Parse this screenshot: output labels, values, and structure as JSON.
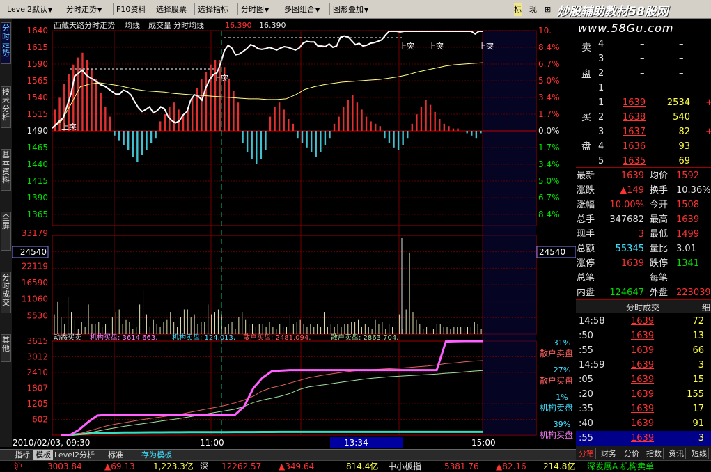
{
  "toolbar": {
    "items": [
      "Level2默认",
      "分时走势",
      "F10资料",
      "选择股票",
      "选择指标",
      "分时图",
      "多图组合",
      "图形叠加",
      "标",
      "现",
      "⊞"
    ]
  },
  "watermark": {
    "title": "炒股辅助教材58股网",
    "url": "www.58Gu.com"
  },
  "left_tabs": [
    "分时走势",
    "技术分析",
    "基本资料",
    "全屏",
    "分时成交",
    "其他"
  ],
  "chart": {
    "title_left": "西藏天路分时走势",
    "legend_labels": [
      "均线",
      "成交量",
      "分时均线"
    ],
    "legend_vals": [
      "16.390",
      "16.390"
    ],
    "price_axis": [
      "1640",
      "1615",
      "1590",
      "1565",
      "1540",
      "1515",
      "1490",
      "1465",
      "1440",
      "1415",
      "1390",
      "1365"
    ],
    "pct_axis": [
      "10.",
      "8.4%",
      "6.7%",
      "5.0%",
      "3.4%",
      "1.7%",
      "0.0%",
      "1.7%",
      "3.4%",
      "5.0%",
      "6.7%",
      "8.4%"
    ],
    "vol_axis": [
      "33179",
      "27648",
      "22119",
      "16590",
      "11060",
      "5530"
    ],
    "vol_marker": "24540",
    "ind_axis": [
      "3615",
      "3012",
      "2410",
      "1807",
      "1205",
      "602"
    ],
    "ind_legend": [
      "动态买卖",
      "机构买盘: 3614.663,",
      "机构卖盘: 124.013,",
      "散户买盘: 2481.094,",
      "散户卖盘: 2863.704,"
    ],
    "ind_right": [
      {
        "pct": "31%",
        "label": "散户卖盘"
      },
      {
        "pct": "27%",
        "label": "散户买盘"
      },
      {
        "pct": "1%",
        "label": "机构卖盘"
      },
      {
        "pct": "39%",
        "label": "机构买盘"
      }
    ],
    "shangtu": "上突",
    "time_axis": [
      "2010/02/03, 09:30",
      "11:00",
      "13:34",
      "15:00"
    ],
    "price_line": [
      1494,
      1500,
      1505,
      1510,
      1528,
      1545,
      1572,
      1576,
      1581,
      1574,
      1570,
      1567,
      1563,
      1559,
      1557,
      1553,
      1549,
      1545,
      1545,
      1551,
      1549,
      1544,
      1534,
      1525,
      1519,
      1522,
      1526,
      1517,
      1520,
      1526,
      1523,
      1511,
      1505,
      1502,
      1505,
      1514,
      1519,
      1536,
      1544,
      1542,
      1536,
      1554,
      1566,
      1574,
      1577,
      1591,
      1610,
      1618,
      1614,
      1604,
      1605,
      1609,
      1613,
      1619,
      1617,
      1613,
      1612,
      1613,
      1615,
      1613,
      1611,
      1614,
      1616,
      1615,
      1613,
      1611,
      1614,
      1621,
      1624,
      1623,
      1623,
      1617,
      1617,
      1616,
      1620,
      1615,
      1617,
      1630,
      1632,
      1631,
      1625,
      1619,
      1621,
      1617,
      1618,
      1621,
      1622,
      1624,
      1626,
      1633,
      1639,
      1639,
      1639,
      1638,
      1639,
      1639,
      1639,
      1639,
      1639,
      1639,
      1639,
      1639,
      1639,
      1639,
      1639,
      1639,
      1639,
      1639,
      1639,
      1639,
      1639,
      1639,
      1639,
      1635,
      1639,
      1639
    ],
    "avg_line": [
      1494,
      1505,
      1530,
      1556,
      1560,
      1562,
      1560,
      1558,
      1555,
      1552,
      1550,
      1549,
      1548,
      1546,
      1545,
      1544,
      1543,
      1542,
      1541,
      1540,
      1539,
      1538,
      1538,
      1537,
      1537,
      1538,
      1544,
      1552,
      1556,
      1559,
      1561,
      1563,
      1564,
      1565,
      1566,
      1567,
      1569,
      1571,
      1574,
      1578,
      1581,
      1584,
      1587,
      1589,
      1590,
      1591,
      1592
    ],
    "vol_bars": [
      8,
      13,
      7,
      4,
      15,
      9,
      6,
      2,
      5,
      3,
      12,
      4,
      4,
      5,
      3,
      4,
      2,
      7,
      9,
      10,
      4,
      6,
      5,
      2,
      3,
      12,
      18,
      8,
      3,
      6,
      4,
      3,
      5,
      6,
      9,
      5,
      3,
      7,
      10,
      10,
      7,
      8,
      4,
      5,
      5,
      12,
      8,
      9,
      10,
      8,
      3,
      4,
      5,
      2,
      7,
      9,
      6,
      4,
      4,
      3,
      4,
      4,
      3,
      5,
      3,
      2,
      4,
      3,
      3,
      8,
      4,
      5,
      6,
      4,
      3,
      4,
      3,
      4,
      3,
      9,
      3,
      4,
      3,
      4,
      3,
      4,
      4,
      5,
      5,
      6,
      3,
      4,
      3,
      2,
      6,
      4,
      5,
      2,
      4,
      3,
      3,
      8,
      2,
      10,
      33,
      9,
      6,
      4,
      2,
      3,
      2,
      2,
      4,
      4,
      3,
      3,
      2,
      3,
      3,
      3,
      3,
      3,
      3,
      5,
      4,
      2
    ],
    "diff_bars": [
      9,
      14,
      20,
      24,
      28,
      31,
      33,
      30,
      26,
      22,
      16,
      10,
      6,
      -2,
      -4,
      -6,
      -8,
      -11,
      -13,
      -10,
      -8,
      -5,
      -3,
      4,
      7,
      10,
      12,
      9,
      7,
      10,
      14,
      18,
      22,
      25,
      28,
      30,
      30,
      27,
      22,
      17,
      12,
      -5,
      -9,
      -12,
      -14,
      -12,
      -8,
      6,
      10,
      12,
      9,
      5,
      3,
      -3,
      -5,
      -7,
      -9,
      -11,
      -9,
      -6,
      -3,
      3,
      6,
      10,
      13,
      15,
      12,
      9,
      6,
      4,
      3,
      2,
      -3,
      -5,
      -7,
      -8,
      -6,
      -3,
      3,
      7,
      10,
      13,
      11,
      8,
      5,
      3,
      2,
      1,
      1,
      0,
      -1,
      -2,
      -3,
      -1
    ],
    "inst_buy": [
      0,
      0,
      200,
      500,
      750,
      780,
      780,
      780,
      780,
      780,
      780,
      780,
      780,
      780,
      780,
      780,
      780,
      780,
      780,
      780,
      1100,
      1800,
      2200,
      2450,
      2480,
      2500,
      2500,
      2500,
      2500,
      2500,
      2500,
      2500,
      2500,
      2500,
      2500,
      2500,
      2500,
      2500,
      2500,
      2500,
      2500,
      2500,
      3600,
      3610,
      3614,
      3615,
      3615
    ],
    "retail_buy": [
      0,
      0,
      10,
      80,
      150,
      220,
      280,
      340,
      390,
      440,
      490,
      540,
      590,
      640,
      700,
      760,
      820,
      880,
      940,
      1000,
      1100,
      1250,
      1350,
      1420,
      1500,
      1600,
      1750,
      1850,
      1900,
      1950,
      2000,
      2050,
      2100,
      2150,
      2190,
      2220,
      2250,
      2270,
      2290,
      2310,
      2330,
      2350,
      2380,
      2400,
      2430,
      2460,
      2481
    ],
    "retail_sell": [
      0,
      0,
      50,
      150,
      250,
      350,
      420,
      480,
      540,
      600,
      650,
      700,
      750,
      800,
      870,
      940,
      1010,
      1070,
      1150,
      1240,
      1350,
      1500,
      1700,
      1820,
      1900,
      2000,
      2100,
      2200,
      2270,
      2330,
      2380,
      2430,
      2470,
      2500,
      2520,
      2540,
      2560,
      2580,
      2600,
      2630,
      2660,
      2700,
      2750,
      2780,
      2820,
      2850,
      2864
    ],
    "inst_sell": [
      0,
      0,
      40,
      60,
      80,
      90,
      95,
      100,
      102,
      105,
      107,
      108,
      110,
      111,
      112,
      113,
      114,
      115,
      116,
      117,
      118,
      119,
      120,
      121,
      122,
      122,
      123,
      123,
      123,
      123,
      124,
      124,
      124,
      124,
      124,
      124,
      124,
      124,
      124,
      124,
      124,
      124,
      124,
      124,
      124,
      124,
      124
    ]
  },
  "quote": {
    "asks": [
      {
        "lvl": "4",
        "p": "–",
        "v": "–"
      },
      {
        "lvl": "3",
        "p": "–",
        "v": "–"
      },
      {
        "lvl": "2",
        "p": "–",
        "v": "–"
      },
      {
        "lvl": "1",
        "p": "–",
        "v": "–"
      }
    ],
    "bids": [
      {
        "lvl": "1",
        "p": "1639",
        "v": "2534",
        "e": "+"
      },
      {
        "lvl": "2",
        "p": "1638",
        "v": "540",
        "e": ""
      },
      {
        "lvl": "3",
        "p": "1637",
        "v": "82",
        "e": "+"
      },
      {
        "lvl": "4",
        "p": "1636",
        "v": "93",
        "e": ""
      },
      {
        "lvl": "5",
        "p": "1635",
        "v": "69",
        "e": ""
      }
    ],
    "side_sell": [
      "卖",
      "盘"
    ],
    "side_buy": [
      "买",
      "盘"
    ],
    "stats": [
      {
        "l1": "最新",
        "v1": "1639",
        "c1": "red",
        "l2": "均价",
        "v2": "1592",
        "c2": "red"
      },
      {
        "l1": "涨跌",
        "v1": "▲149",
        "c1": "red",
        "l2": "换手",
        "v2": "10.36%",
        "c2": "wht"
      },
      {
        "l1": "涨幅",
        "v1": "10.00%",
        "c1": "red",
        "l2": "今开",
        "v2": "1508",
        "c2": "red"
      },
      {
        "l1": "总手",
        "v1": "347682",
        "c1": "wht",
        "l2": "最高",
        "v2": "1639",
        "c2": "red"
      },
      {
        "l1": "现手",
        "v1": "3",
        "c1": "red",
        "l2": "最低",
        "v2": "1499",
        "c2": "red"
      },
      {
        "l1": "总额",
        "v1": "55345",
        "c1": "cyan",
        "l2": "量比",
        "v2": "3.01",
        "c2": "wht"
      },
      {
        "l1": "涨停",
        "v1": "1639",
        "c1": "red",
        "l2": "跌停",
        "v2": "1341",
        "c2": "grn"
      },
      {
        "l1": "总笔",
        "v1": "–",
        "c1": "wht",
        "l2": "每笔",
        "v2": "–",
        "c2": "wht"
      },
      {
        "l1": "内盘",
        "v1": "124647",
        "c1": "grn",
        "l2": "外盘",
        "v2": "223039",
        "c2": "red"
      }
    ],
    "trades_title": "分时成交",
    "trades_more": "细",
    "trades": [
      {
        "t": "14:58",
        "p": "1639",
        "v": "72"
      },
      {
        "t": ":50",
        "p": "1639",
        "v": "13"
      },
      {
        "t": ":55",
        "p": "1639",
        "v": "66"
      },
      {
        "t": "14:59",
        "p": "1639",
        "v": "3"
      },
      {
        "t": ":05",
        "p": "1639",
        "v": "15"
      },
      {
        "t": ":20",
        "p": "1639",
        "v": "155"
      },
      {
        "t": ":35",
        "p": "1639",
        "v": "17"
      },
      {
        "t": ":40",
        "p": "1639",
        "v": "91"
      },
      {
        "t": ":55",
        "p": "1639",
        "v": "3"
      }
    ]
  },
  "bottom_tabs": [
    "指标",
    "模板",
    "Level2分析",
    "标准",
    "存为模板"
  ],
  "right_tabs": [
    "分笔",
    "财务",
    "分价",
    "指数",
    "资讯",
    "短线"
  ],
  "ticker": [
    {
      "t": "沪",
      "c": "red"
    },
    {
      "t": "3003.84",
      "c": "red"
    },
    {
      "t": "▲69.13",
      "c": "red"
    },
    {
      "t": "1,223.3亿",
      "c": "yel"
    },
    {
      "t": "深",
      "c": "wht"
    },
    {
      "t": "12262.57",
      "c": "red"
    },
    {
      "t": "▲349.64",
      "c": "red"
    },
    {
      "t": "814.4亿",
      "c": "yel"
    },
    {
      "t": "中小板指",
      "c": "wht"
    },
    {
      "t": "5381.76",
      "c": "red"
    },
    {
      "t": "▲82.16",
      "c": "red"
    },
    {
      "t": "214.8亿",
      "c": "yel"
    },
    {
      "t": "深发展A 机构卖单",
      "c": "grn"
    }
  ]
}
